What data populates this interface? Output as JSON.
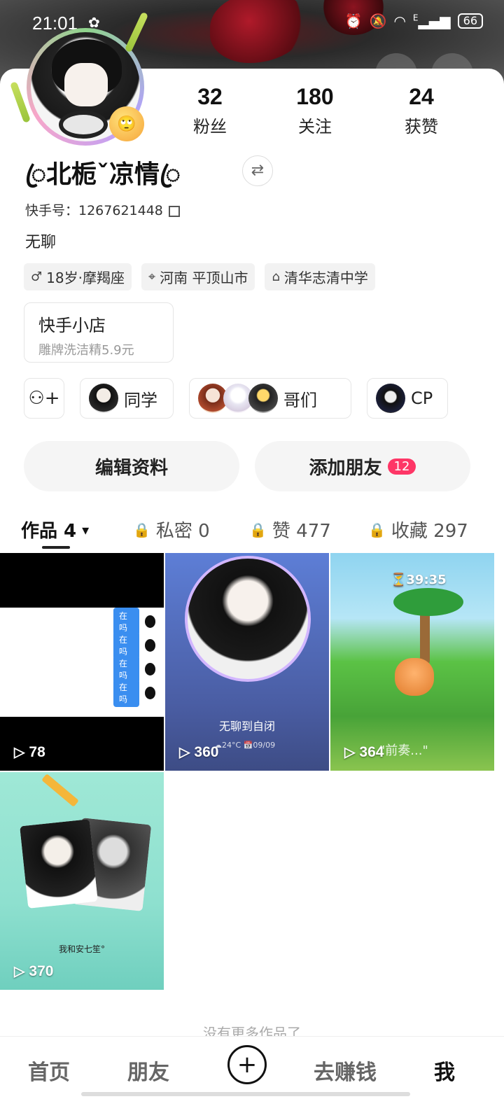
{
  "status": {
    "time": "21:01",
    "battery": "66",
    "net": "E"
  },
  "profile": {
    "nickname": "ꦿ北栀ˇ凉情ꦿ",
    "kuaishou_id": "快手号：1267621448",
    "bio": "无聊",
    "stats": [
      {
        "num": "32",
        "label": "粉丝"
      },
      {
        "num": "180",
        "label": "关注"
      },
      {
        "num": "24",
        "label": "获赞"
      }
    ],
    "tags": [
      {
        "icon": "♂",
        "text": "18岁·摩羯座"
      },
      {
        "icon": "⌖",
        "text": "河南 平顶山市"
      },
      {
        "icon": "⌂",
        "text": "清华志清中学"
      }
    ]
  },
  "shop": {
    "title": "快手小店",
    "subtitle": "雕牌洗洁精5.9元"
  },
  "groups": [
    {
      "label": "同学"
    },
    {
      "label": "哥们"
    },
    {
      "label": "CP"
    }
  ],
  "actions": {
    "edit": "编辑资料",
    "add_friend": "添加朋友",
    "add_friend_badge": "12"
  },
  "tabs": [
    {
      "label": "作品 4",
      "arrow": "▾"
    },
    {
      "label": "私密 0"
    },
    {
      "label": "赞 477"
    },
    {
      "label": "收藏 297"
    }
  ],
  "works": [
    {
      "plays": "78",
      "chat": "在吗"
    },
    {
      "plays": "360",
      "caption": "无聊到自闭",
      "meta": "☁24°C 📅09/09"
    },
    {
      "plays": "364",
      "timer": "⏳39:35",
      "caption": "\"前奏...\""
    },
    {
      "plays": "370",
      "caption": "我和安七笙°"
    }
  ],
  "no_more": "没有更多作品了",
  "nav": {
    "home": "首页",
    "friends": "朋友",
    "plus": "+",
    "earn": "去赚钱",
    "me": "我"
  }
}
